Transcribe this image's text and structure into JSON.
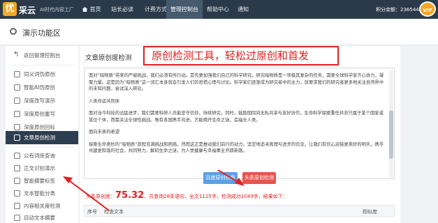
{
  "nav": {
    "brand": "采云",
    "logo_char": "优",
    "slogan": "AI时代内容工厂",
    "items": [
      "首页",
      "站长必读",
      "计费方式",
      "管理控制台",
      "帮助中心",
      "通知"
    ],
    "points": "积分余额：2365445",
    "vip": "VIP"
  },
  "page": {
    "title": "演示功能区"
  },
  "sidebar": {
    "items": [
      {
        "label": "返回管理控制台",
        "icon": "back-icon"
      },
      {
        "label": "同义词伪原创",
        "icon": "doc-icon"
      },
      {
        "label": "智能AI伪原创",
        "icon": "ai-icon"
      },
      {
        "label": "深度改写演示",
        "icon": "edit-icon"
      },
      {
        "label": "深度原创重写",
        "icon": "rewrite-icon"
      },
      {
        "label": "深度原创回标",
        "icon": "mark-icon"
      },
      {
        "label": "文章原创检测",
        "icon": "check-icon"
      },
      {
        "label": "公有词库查询",
        "icon": "db-icon"
      },
      {
        "label": "正文识别演示",
        "icon": "text-icon"
      },
      {
        "label": "智能摘要标签",
        "icon": "tag-icon"
      },
      {
        "label": "文本智能分类",
        "icon": "category-icon"
      },
      {
        "label": "内容相关度检测",
        "icon": "relevance-icon"
      },
      {
        "label": "自动文本摘要",
        "icon": "summary-icon"
      }
    ],
    "active_index": 6
  },
  "main": {
    "card_title": "文章原创度检测",
    "annotation": "原创检测工具，轻松过原创和首发",
    "paragraphs": [
      "面对“暗物质”带来的严峻挑战，我们必须有所行动。首先要加强我们自己的科学研究。研究暗物质是一项极其复杂的任务，需要全球科学家齐心协力，凝聚力量。这是因为“暗物质”这一词汇本身就会引发人们的恐慌心理与讨论。科学家们逐渐成为研究者中的主力，就要求我们的研究者更多地关注自然界中的未知问题，尝试深入研究。",
      "人类命运共同体",
      "面对当今科技的迅猛进步，我们需要科研人员能坚守信仰，持续研究，同时，鼓励国际间无私共享与友好协作。生命科学探索重任并非只属于某个国家或某位个体，而需关注全球性挑战。唯有各国携手共进，方能揭开生命之谜，造福全人类。",
      "面向未来的希望",
      "探索生命奥妙的“暗物质”旅程充满挑战和困惑。然而这正是推动我们前行的动力。坚定地追寻真理与进步的信念，让我们有信心迎接更美好的明天。携手共建更和谐的社会，共同努力，解码生命之谜，为人类健康与幸福事业开辟新路。"
    ],
    "btn_baidu": "百度原创检测",
    "btn_toutiao": "头条原创检测",
    "result_prefix": "头条原创度：",
    "score": "75.32",
    "result_suffix": "，共查询28条语句，全文1125字，检测成功1049字，结果如下：",
    "table_headers": [
      "序号",
      "检查文本",
      "相似度"
    ]
  }
}
